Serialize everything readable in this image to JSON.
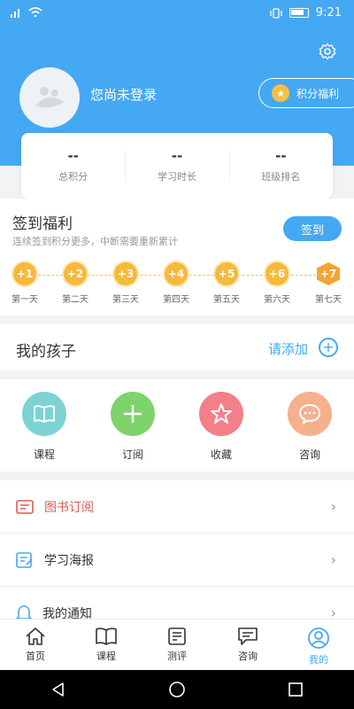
{
  "status": {
    "time": "9:21"
  },
  "header": {
    "user_name": "您尚未登录",
    "points_label": "积分福利"
  },
  "stats": [
    {
      "value": "--",
      "label": "总积分"
    },
    {
      "value": "--",
      "label": "学习时长"
    },
    {
      "value": "--",
      "label": "班级排名"
    }
  ],
  "signin": {
    "title": "签到福利",
    "subtitle": "连续签到积分更多，中断需要重新累计",
    "button": "签到",
    "days": [
      {
        "reward": "+1",
        "label": "第一天"
      },
      {
        "reward": "+2",
        "label": "第二天"
      },
      {
        "reward": "+3",
        "label": "第三天"
      },
      {
        "reward": "+4",
        "label": "第四天"
      },
      {
        "reward": "+5",
        "label": "第五天"
      },
      {
        "reward": "+6",
        "label": "第六天"
      },
      {
        "reward": "+7",
        "label": "第七天"
      }
    ]
  },
  "children": {
    "title": "我的孩子",
    "add_label": "请添加"
  },
  "grid": [
    {
      "label": "课程",
      "icon": "book-icon",
      "color": "#7dd3d3"
    },
    {
      "label": "订阅",
      "icon": "plus-icon",
      "color": "#7ed36a"
    },
    {
      "label": "收藏",
      "icon": "star-icon",
      "color": "#f27f8a"
    },
    {
      "label": "咨询",
      "icon": "chat-icon",
      "color": "#f5b08e"
    }
  ],
  "list": [
    {
      "label": "图书订阅",
      "icon": "book-subscribe-icon",
      "color": "#e05a4f"
    },
    {
      "label": "学习海报",
      "icon": "poster-icon",
      "color": "#45a8f2"
    },
    {
      "label": "我的通知",
      "icon": "bell-icon",
      "color": "#45a8f2"
    }
  ],
  "tabs": [
    {
      "label": "首页",
      "icon": "home-icon"
    },
    {
      "label": "课程",
      "icon": "book-icon"
    },
    {
      "label": "测评",
      "icon": "checklist-icon"
    },
    {
      "label": "咨询",
      "icon": "message-icon"
    },
    {
      "label": "我的",
      "icon": "profile-icon",
      "active": true
    }
  ],
  "colors": {
    "primary": "#45a8f2",
    "coin": "#f6b93b"
  }
}
